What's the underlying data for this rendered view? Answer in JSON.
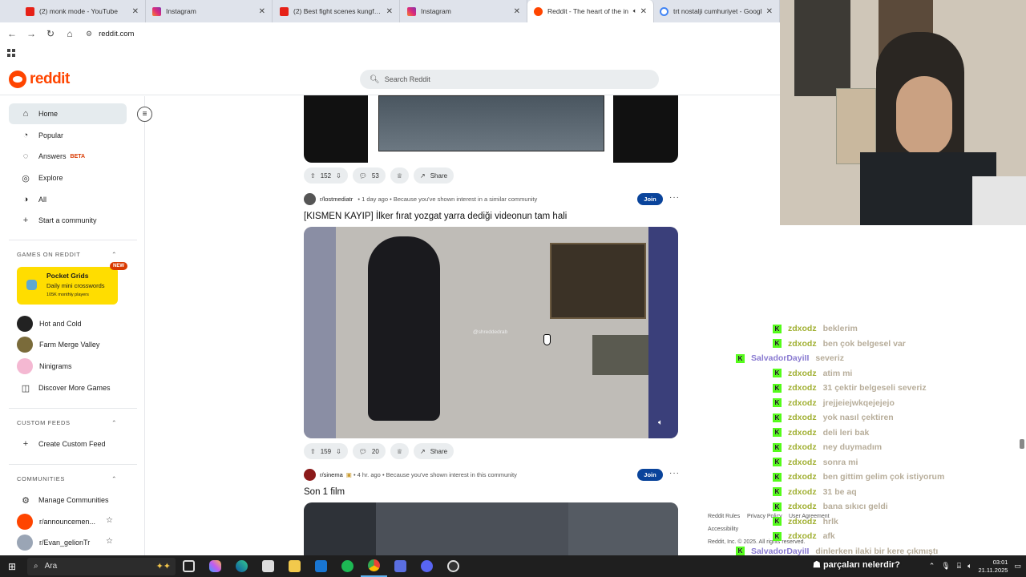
{
  "tabs": [
    {
      "title": "(2) monk mode - YouTube",
      "favicon": "youtube-icon"
    },
    {
      "title": "Instagram",
      "favicon": "instagram-icon"
    },
    {
      "title": "(2) Best fight scenes kungfu ch",
      "favicon": "youtube-icon"
    },
    {
      "title": "Instagram",
      "favicon": "instagram-icon"
    },
    {
      "title": "Reddit - The heart of the in",
      "favicon": "reddit-icon",
      "active": true
    },
    {
      "title": "trt nostalji cumhuriyet - Googl",
      "favicon": "google-icon"
    }
  ],
  "browser": {
    "url": "reddit.com"
  },
  "header": {
    "logo_text": "reddit",
    "search_placeholder": "Search Reddit"
  },
  "sidebar": {
    "nav": [
      {
        "label": "Home",
        "icon": "home-icon"
      },
      {
        "label": "Popular",
        "icon": "popular-icon"
      },
      {
        "label": "Answers",
        "badge": "BETA",
        "icon": "answers-icon"
      },
      {
        "label": "Explore",
        "icon": "explore-icon"
      },
      {
        "label": "All",
        "icon": "all-icon"
      },
      {
        "label": "Start a community",
        "icon": "plus-icon"
      }
    ],
    "games_heading": "GAMES ON REDDIT",
    "promo": {
      "title": "Pocket Grids",
      "subtitle": "Daily mini crosswords",
      "meta": "105K monthly players",
      "badge": "NEW"
    },
    "games": [
      "Hot and Cold",
      "Farm Merge Valley",
      "Ninigrams",
      "Discover More Games"
    ],
    "custom_heading": "CUSTOM FEEDS",
    "create_feed": "Create Custom Feed",
    "communities_heading": "COMMUNITIES",
    "manage": "Manage Communities",
    "communities": [
      "r/announcemen...",
      "r/Evan_gelionTr"
    ]
  },
  "posts": [
    {
      "votes": "152",
      "comments": "53",
      "share": "Share"
    },
    {
      "subreddit": "r/lostmediatr",
      "age": "1 day ago",
      "reason": "Because you've shown interest in a similar community",
      "join": "Join",
      "title": "[KISMEN KAYIP] İlker fırat yozgat yarra dediği videonun tam hali",
      "watermark": "@shreddedrab",
      "votes": "159",
      "comments": "20",
      "share": "Share"
    },
    {
      "subreddit": "r/sinema",
      "age": "4 hr. ago",
      "reason": "Because you've shown interest in this community",
      "join": "Join",
      "title": "Son 1 film"
    }
  ],
  "footer": {
    "rules": "Reddit Rules",
    "privacy": "Privacy Policy",
    "agreement": "User Agreement",
    "accessibility": "Accessibility",
    "copyright": "Reddit, Inc. © 2025. All rights reserved."
  },
  "chat": [
    {
      "user": "zdxodz",
      "msg": "beklerim"
    },
    {
      "user": "zdxodz",
      "msg": "ben çok belgesel var"
    },
    {
      "user": "SalvadorDayiII",
      "msg": "severiz",
      "alt": true
    },
    {
      "user": "zdxodz",
      "msg": "atim mi"
    },
    {
      "user": "zdxodz",
      "msg": "31 çektir belgeseli severiz"
    },
    {
      "user": "zdxodz",
      "msg": "jrejjeiejwkqejejejo"
    },
    {
      "user": "zdxodz",
      "msg": "yok nasıl çektiren"
    },
    {
      "user": "zdxodz",
      "msg": "deli leri bak"
    },
    {
      "user": "zdxodz",
      "msg": "ney duymadım"
    },
    {
      "user": "zdxodz",
      "msg": "sonra mi"
    },
    {
      "user": "zdxodz",
      "msg": "ben gittim gelim çok istiyorum"
    },
    {
      "user": "zdxodz",
      "msg": "31 be aq"
    },
    {
      "user": "zdxodz",
      "msg": "bana sıkıcı geldi"
    },
    {
      "user": "zdxodz",
      "msg": "hrlk"
    },
    {
      "user": "zdxodz",
      "msg": "afk"
    },
    {
      "user": "SalvadorDayiII",
      "msg": "dinlerken ilaki bir kere çıkmıştı",
      "alt": true
    }
  ],
  "taskbar": {
    "search_text": "Ara",
    "ticker": "parçaları nelerdir?",
    "time": "03:01",
    "date": "21.11.2025"
  },
  "colors": {
    "reddit_orange": "#ff4500",
    "join_blue": "#0a449b",
    "kick_green": "#53fc18"
  }
}
